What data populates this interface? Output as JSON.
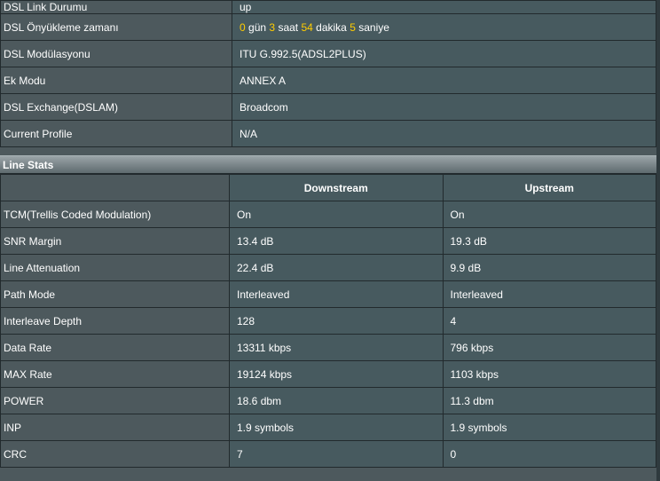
{
  "status": {
    "rows": [
      {
        "label": "DSL Link Durumu",
        "value": "up"
      },
      {
        "label": "DSL Önyükleme zamanı",
        "uptime": {
          "days": "0",
          "days_unit": "gün",
          "hours": "3",
          "hours_unit": "saat",
          "minutes": "54",
          "minutes_unit": "dakika",
          "seconds": "5",
          "seconds_unit": "saniye"
        }
      },
      {
        "label": "DSL Modülasyonu",
        "value": "ITU G.992.5(ADSL2PLUS)"
      },
      {
        "label": "Ek Modu",
        "value": "ANNEX A"
      },
      {
        "label": "DSL Exchange(DSLAM)",
        "value": "Broadcom"
      },
      {
        "label": "Current Profile",
        "value": "N/A"
      }
    ]
  },
  "line_stats": {
    "title": "Line Stats",
    "columns": [
      "Downstream",
      "Upstream"
    ],
    "rows": [
      {
        "label": "TCM(Trellis Coded Modulation)",
        "down": "On",
        "up": "On"
      },
      {
        "label": "SNR Margin",
        "down": "13.4 dB",
        "up": "19.3 dB"
      },
      {
        "label": "Line Attenuation",
        "down": "22.4 dB",
        "up": "9.9 dB"
      },
      {
        "label": "Path Mode",
        "down": "Interleaved",
        "up": "Interleaved"
      },
      {
        "label": "Interleave Depth",
        "down": "128",
        "up": "4"
      },
      {
        "label": "Data Rate",
        "down": "13311 kbps",
        "up": "796 kbps"
      },
      {
        "label": "MAX Rate",
        "down": "19124 kbps",
        "up": "1103 kbps"
      },
      {
        "label": "POWER",
        "down": "18.6 dbm",
        "up": "11.3 dbm"
      },
      {
        "label": "INP",
        "down": "1.9 symbols",
        "up": "1.9 symbols"
      },
      {
        "label": "CRC",
        "down": "7",
        "up": "0"
      }
    ]
  },
  "colors": {
    "highlight": "#ffcc00",
    "panel": "#4d595d",
    "cell": "#475a5f",
    "border": "#222a2d"
  }
}
